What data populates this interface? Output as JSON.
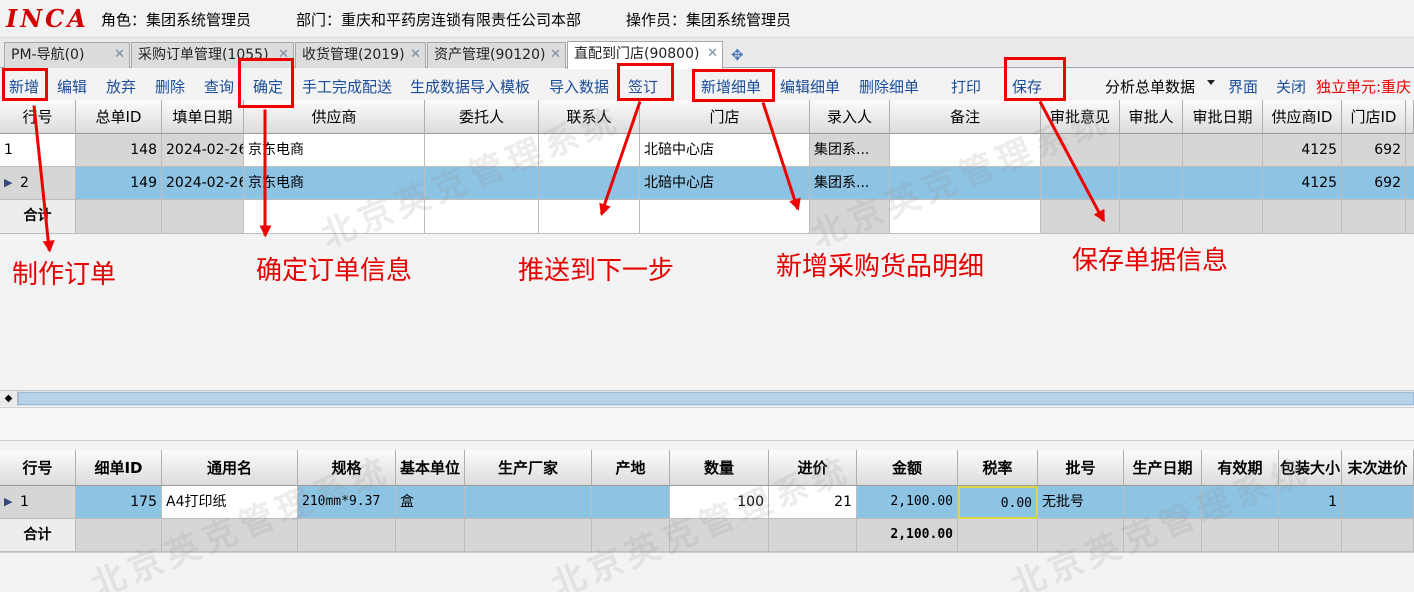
{
  "header": {
    "logo": "INCA",
    "role": "角色：集团系统管理员",
    "department": "部门：重庆和平药房连锁有限责任公司本部",
    "operator": "操作员：集团系统管理员"
  },
  "tabs": [
    {
      "label": "PM-导航(0)",
      "close": "✕"
    },
    {
      "label": "采购订单管理(1055)",
      "close": "✕"
    },
    {
      "label": "收货管理(2019)",
      "close": "✕"
    },
    {
      "label": "资产管理(90120)",
      "close": "✕"
    },
    {
      "label": "直配到门店(90800)",
      "close": "✕"
    }
  ],
  "add_tab_icon": "plus-circle-icon",
  "toolbar": {
    "add": "新增",
    "edit": "编辑",
    "discard": "放弃",
    "delete": "删除",
    "query": "查询",
    "confirm": "确定",
    "manual_complete": "手工完成配送",
    "gen_template": "生成数据导入模板",
    "import": "导入数据",
    "sign": "签订",
    "add_detail": "新增细单",
    "edit_detail": "编辑细单",
    "delete_detail": "删除细单",
    "print": "打印",
    "save": "保存",
    "analyze": "分析总单数据",
    "view": "界面",
    "close": "关闭",
    "unit": "独立单元:重庆"
  },
  "master_grid": {
    "columns": [
      "行号",
      "总单ID",
      "填单日期",
      "供应商",
      "委托人",
      "联系人",
      "门店",
      "录入人",
      "备注",
      "审批意见",
      "审批人",
      "审批日期",
      "供应商ID",
      "门店ID"
    ],
    "rows": [
      {
        "row": "1",
        "id": "148",
        "date": "2024-02-26",
        "supplier": "京东电商",
        "client": "",
        "contact": "",
        "store": "北碚中心店",
        "entered_by": "集团系...",
        "note": "",
        "opinion": "",
        "approver": "",
        "approve_date": "",
        "supplier_id": "4125",
        "store_id": "692"
      },
      {
        "row": "2",
        "id": "149",
        "date": "2024-02-26",
        "supplier": "京东电商",
        "client": "",
        "contact": "",
        "store": "北碚中心店",
        "entered_by": "集团系...",
        "note": "",
        "opinion": "",
        "approver": "",
        "approve_date": "",
        "supplier_id": "4125",
        "store_id": "692"
      }
    ],
    "total_label": "合计"
  },
  "detail_grid": {
    "columns": [
      "行号",
      "细单ID",
      "通用名",
      "规格",
      "基本单位",
      "生产厂家",
      "产地",
      "数量",
      "进价",
      "金额",
      "税率",
      "批号",
      "生产日期",
      "有效期",
      "包装大小",
      "末次进价"
    ],
    "rows": [
      {
        "row": "1",
        "id": "175",
        "name": "A4打印纸",
        "spec": "210mm*9.37",
        "unit": "盒",
        "maker": "",
        "origin": "",
        "qty": "100",
        "price": "21",
        "amount": "2,100.00",
        "tax": "0.00",
        "batch": "无批号",
        "mfg_date": "",
        "expiry": "",
        "pack": "1",
        "last_price": ""
      }
    ],
    "total_label": "合计",
    "total_amount": "2,100.00"
  },
  "annotations": {
    "make_order": "制作订单",
    "confirm_info": "确定订单信息",
    "push_next": "推送到下一步",
    "add_goods": "新增采购货品明细",
    "save_info": "保存单据信息"
  },
  "watermark": "北京英克管理系统",
  "colors": {
    "selected_row": "#8dc3e3",
    "gray_cell": "#d6d6d6",
    "annotation": "#ee0000",
    "logo": "#d20000",
    "toolbar_text": "#1a4c99"
  }
}
